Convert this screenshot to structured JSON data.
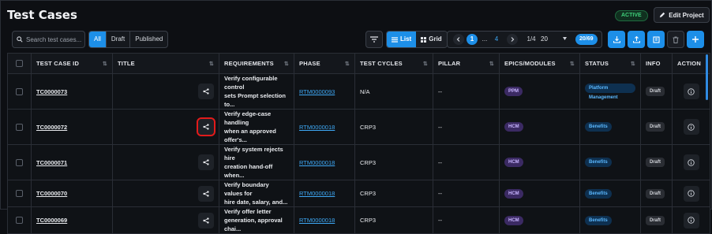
{
  "page": {
    "title": "Test Cases",
    "status": "ACTIVE",
    "edit_label": "Edit Project"
  },
  "toolbar": {
    "search_placeholder": "Search test cases...",
    "filters": [
      "All",
      "Draft",
      "Published"
    ],
    "views": [
      "List",
      "Grid"
    ],
    "pagination": {
      "first": "1",
      "ellipsis": "...",
      "last": "4",
      "page_of": "1/4",
      "page_size": "20",
      "count": "20/69"
    }
  },
  "table": {
    "columns": [
      "TEST CASE ID",
      "TITLE",
      "REQUIREMENTS",
      "PHASE",
      "TEST CYCLES",
      "PILLAR",
      "EPICS/MODULES",
      "STATUS",
      "INFO",
      "ACTION"
    ],
    "rows": [
      {
        "id": "TC0000073",
        "title1": "Verify configurable control",
        "title2": "sets Prompt selection to...",
        "req": "RTM0000093",
        "phase": "N/A",
        "cycles": "--",
        "pillar": "PPM",
        "epic": "Platform Management",
        "status": "Draft"
      },
      {
        "id": "TC0000072",
        "title1": "Verify edge-case handling",
        "title2": "when an approved offer's...",
        "req": "RTM0000018",
        "phase": "CRP3",
        "cycles": "--",
        "pillar": "HCM",
        "epic": "Benefits",
        "status": "Draft"
      },
      {
        "id": "TC0000071",
        "title1": "Verify system rejects hire",
        "title2": "creation hand-off when...",
        "req": "RTM0000018",
        "phase": "CRP3",
        "cycles": "--",
        "pillar": "HCM",
        "epic": "Benefits",
        "status": "Draft"
      },
      {
        "id": "TC0000070",
        "title1": "Verify boundary values for",
        "title2": "hire date, salary, and...",
        "req": "RTM0000018",
        "phase": "CRP3",
        "cycles": "--",
        "pillar": "HCM",
        "epic": "Benefits",
        "status": "Draft"
      },
      {
        "id": "TC0000069",
        "title1": "Verify offer letter",
        "title2": "generation, approval chai...",
        "req": "RTM0000018",
        "phase": "CRP3",
        "cycles": "--",
        "pillar": "HCM",
        "epic": "Benefits",
        "status": "Draft"
      }
    ]
  },
  "icons": {
    "edit": "pencil-icon",
    "search": "search-icon",
    "filter": "filter-icon",
    "download": "download-icon",
    "upload": "upload-icon",
    "book": "book-icon",
    "trash": "trash-icon",
    "add": "plus-icon",
    "share": "share-icon",
    "info": "info-icon",
    "more": "more-vertical-icon"
  },
  "colors": {
    "accent": "#1d8fe8",
    "link": "#3ea8f5",
    "active": "#3fd07a",
    "highlight": "#e21b1b"
  }
}
